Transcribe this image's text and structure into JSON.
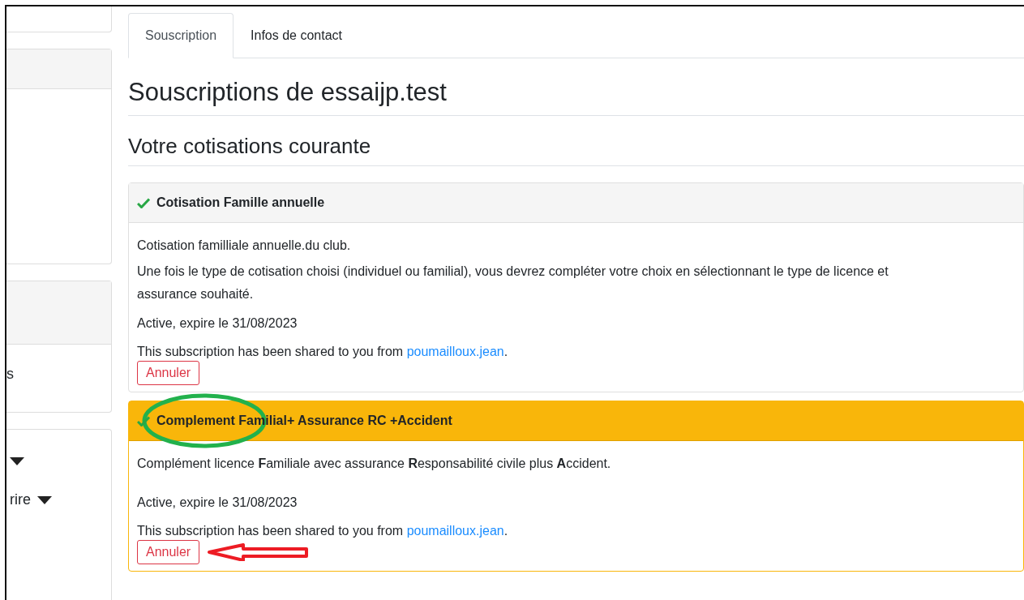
{
  "sidebar": {
    "panels": [
      {
        "header": false
      },
      {
        "header": true
      },
      {
        "header": true,
        "items": [
          {
            "kind": "text",
            "label": "s"
          }
        ]
      },
      {
        "header": false,
        "items": [
          {
            "kind": "caret"
          },
          {
            "kind": "dropdown",
            "label": "rire"
          }
        ]
      }
    ]
  },
  "tabs": [
    {
      "label": "Souscription",
      "selected": true
    },
    {
      "label": "Infos de contact",
      "selected": false
    }
  ],
  "title": "Souscriptions de essaijp.test",
  "subtitle": "Votre cotisations courante",
  "cards": [
    {
      "kind": "plain",
      "title": "Cotisation Famille annuelle",
      "description": [
        "Cotisation familliale annuelle.du club.",
        "Une fois le type de cotisation choisi (individuel ou familial), vous devrez compléter votre choix en sélectionnant le type de licence et assurance souhaité."
      ],
      "status": "Active, expire le 31/08/2023",
      "shared_prefix": "This subscription has been shared to you from ",
      "shared_by": "poumailloux.jean",
      "shared_suffix": ".",
      "button": "Annuler",
      "annotated": false
    },
    {
      "kind": "highlighted",
      "title": "Complement Familial+ Assurance RC +Accident",
      "description": [
        "Complément licence **F**amiliale avec assurance **R**esponsabilité civile plus **A**ccident."
      ],
      "status": "Active, expire le 31/08/2023",
      "shared_prefix": "This subscription has been shared to you from ",
      "shared_by": "poumailloux.jean",
      "shared_suffix": ".",
      "button": "Annuler",
      "annotated": true
    }
  ]
}
